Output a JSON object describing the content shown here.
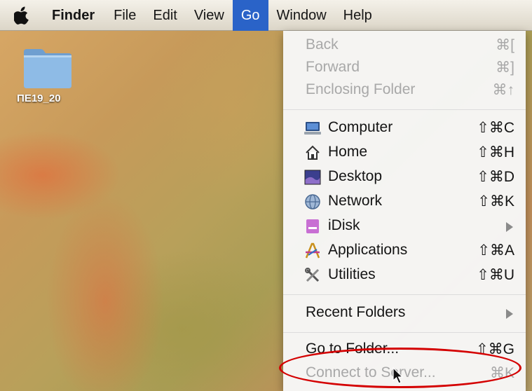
{
  "menubar": {
    "items": [
      "Finder",
      "File",
      "Edit",
      "View",
      "Go",
      "Window",
      "Help"
    ],
    "active": "Go"
  },
  "desktop": {
    "folder_label": "ΠΕ19_20"
  },
  "go_menu": {
    "navigation": [
      {
        "label": "Back",
        "shortcut": "⌘[",
        "enabled": false
      },
      {
        "label": "Forward",
        "shortcut": "⌘]",
        "enabled": false
      },
      {
        "label": "Enclosing Folder",
        "shortcut": "⌘↑",
        "enabled": false
      }
    ],
    "locations": [
      {
        "label": "Computer",
        "shortcut": "⇧⌘C",
        "icon": "computer-icon"
      },
      {
        "label": "Home",
        "shortcut": "⇧⌘H",
        "icon": "home-icon"
      },
      {
        "label": "Desktop",
        "shortcut": "⇧⌘D",
        "icon": "desktop-icon"
      },
      {
        "label": "Network",
        "shortcut": "⇧⌘K",
        "icon": "network-icon"
      },
      {
        "label": "iDisk",
        "shortcut": "",
        "icon": "idisk-icon",
        "submenu": true
      },
      {
        "label": "Applications",
        "shortcut": "⇧⌘A",
        "icon": "applications-icon"
      },
      {
        "label": "Utilities",
        "shortcut": "⇧⌘U",
        "icon": "utilities-icon"
      }
    ],
    "recent": {
      "label": "Recent Folders",
      "submenu": true
    },
    "go_to_folder": {
      "label": "Go to Folder...",
      "shortcut": "⇧⌘G"
    },
    "connect_to_server": {
      "label": "Connect to Server...",
      "shortcut": "⌘K",
      "enabled": false
    }
  },
  "colors": {
    "menu_highlight": "#2a63c8",
    "annotation": "#d40000"
  }
}
